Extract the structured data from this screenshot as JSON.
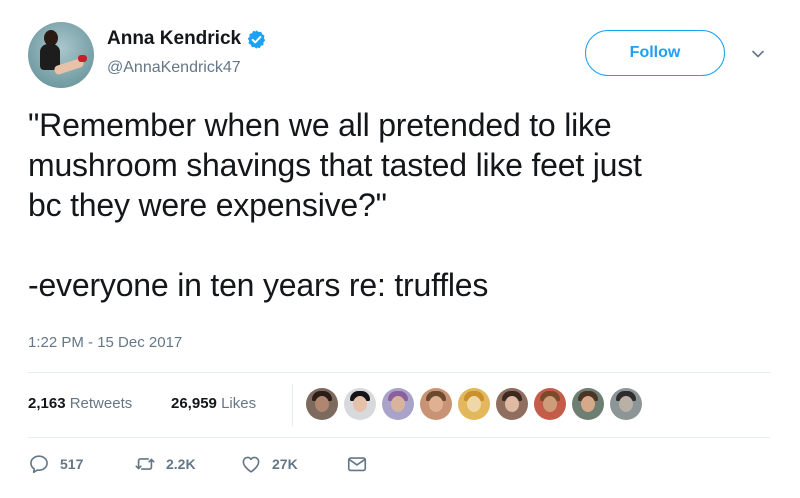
{
  "author": {
    "display_name": "Anna Kendrick",
    "handle": "@AnnaKendrick47",
    "verified": true
  },
  "follow_label": "Follow",
  "tweet": {
    "text": "\"Remember when we all pretended to like\nmushroom shavings that tasted like feet just\nbc they were expensive?\"\n\n-everyone in ten years re: truffles",
    "timestamp": "1:22 PM - 15 Dec 2017"
  },
  "stats": {
    "retweets_count": "2,163",
    "retweets_label": "Retweets",
    "likes_count": "26,959",
    "likes_label": "Likes"
  },
  "likers": [
    {
      "face": "#b08670",
      "hair": "#2a1d17",
      "bg": "#7c6a5e"
    },
    {
      "face": "#e5c1ab",
      "hair": "#151515",
      "bg": "#d7d9dc"
    },
    {
      "face": "#d9b49d",
      "hair": "#8c5f9f",
      "bg": "#a9a2c9"
    },
    {
      "face": "#e0b092",
      "hair": "#6b4a2f",
      "bg": "#c99475"
    },
    {
      "face": "#f0d7a8",
      "hair": "#c9902e",
      "bg": "#e3b85c"
    },
    {
      "face": "#dfb9a2",
      "hair": "#3b2a22",
      "bg": "#8f6e5f"
    },
    {
      "face": "#cf9c79",
      "hair": "#7a4b2b",
      "bg": "#c45c4a"
    },
    {
      "face": "#d6a98a",
      "hair": "#4b3425",
      "bg": "#6d7f73"
    },
    {
      "face": "#b9b0a6",
      "hair": "#2d2d2d",
      "bg": "#8e9597"
    }
  ],
  "actions": {
    "replies": "517",
    "retweets": "2.2K",
    "likes": "27K"
  },
  "colors": {
    "accent": "#1da1f2",
    "text": "#14171a",
    "secondary": "#657786",
    "divider": "#e6ecf0"
  }
}
